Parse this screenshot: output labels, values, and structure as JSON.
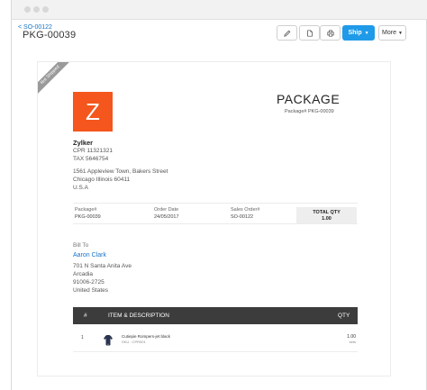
{
  "header": {
    "back_link": "< SO-00122",
    "package_id": "PKG-00039",
    "ship_label": "Ship",
    "more_label": "More"
  },
  "document": {
    "ribbon": "Not Shipped",
    "logo_letter": "Z",
    "title": "PACKAGE",
    "package_number": "Package# PKG-00039",
    "company": {
      "name": "Zylker",
      "cpr": "CPR 11321321",
      "tax": "TAX 5646754",
      "address_line1": "1561 Appleview Town, Bakers Street",
      "address_line2": "Chicago Illinois 60411",
      "address_line3": "U.S.A"
    },
    "meta": {
      "package_label": "Package#",
      "package_value": "PKG-00039",
      "order_date_label": "Order Date",
      "order_date_value": "24/05/2017",
      "sales_order_label": "Sales Order#",
      "sales_order_value": "SO-00122",
      "total_qty_label": "TOTAL QTY",
      "total_qty_value": "1.00"
    },
    "bill_to": {
      "label": "Bill To",
      "name": "Aaron Clark",
      "line1": "701 N Santa Anita Ave",
      "line2": "Arcadia",
      "line3": "91006-2725",
      "line4": "United States"
    },
    "table": {
      "col_num": "#",
      "col_item": "ITEM & DESCRIPTION",
      "col_qty": "QTY",
      "rows": [
        {
          "num": "1",
          "name": "Cutiepie Rompers-jet black",
          "sku": "SKU : CPR001",
          "qty": "1.00",
          "unit": "sets"
        }
      ]
    }
  },
  "icons": {
    "edit": "pencil-icon",
    "pdf": "pdf-icon",
    "print": "printer-icon",
    "item": "romper-icon"
  },
  "colors": {
    "accent": "#1f9ae8",
    "logo": "#f4561d",
    "link": "#1a73c9",
    "table_header": "#3c3c3c"
  }
}
